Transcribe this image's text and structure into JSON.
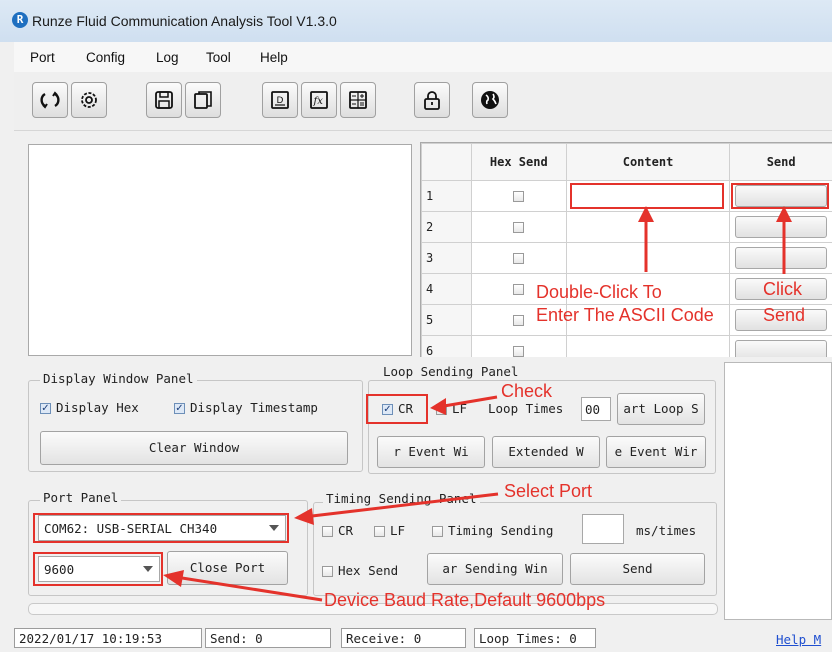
{
  "window": {
    "title": "Runze Fluid Communication Analysis Tool V1.3.0"
  },
  "menu": [
    "Port",
    "Config",
    "Log",
    "Tool",
    "Help"
  ],
  "toolbar": {
    "icons": [
      "refresh-icon",
      "settings-icon",
      "save-icon",
      "copy-icon",
      "document-icon",
      "function-icon",
      "calculator-icon",
      "lock-icon",
      "globe-icon"
    ]
  },
  "send_table": {
    "headers": [
      "",
      "Hex Send",
      "Content",
      "Send"
    ],
    "rows": [
      {
        "num": "1",
        "hex": false,
        "content": ""
      },
      {
        "num": "2",
        "hex": false,
        "content": ""
      },
      {
        "num": "3",
        "hex": false,
        "content": ""
      },
      {
        "num": "4",
        "hex": false,
        "content": ""
      },
      {
        "num": "5",
        "hex": false,
        "content": ""
      },
      {
        "num": "6",
        "hex": false,
        "content": ""
      }
    ]
  },
  "display_panel": {
    "legend": "Display Window Panel",
    "display_hex": "Display Hex",
    "display_timestamp": "Display Timestamp",
    "clear_button": "Clear Window"
  },
  "loop_panel": {
    "legend": "Loop Sending Panel",
    "cr": "CR",
    "lf": "LF",
    "loop_times_label": "Loop Times",
    "loop_times_value": "00",
    "start_button": "art Loop S",
    "btn1": "r Event Wi",
    "btn2": "Extended W",
    "btn3": "e Event Wir"
  },
  "port_panel": {
    "legend": "Port Panel",
    "port_value": "COM62: USB-SERIAL CH340",
    "baud_value": "9600",
    "close_button": "Close Port"
  },
  "timing_panel": {
    "legend": "Timing Sending Panel",
    "cr": "CR",
    "lf": "LF",
    "timing_label": "Timing Sending",
    "ms_value": "",
    "unit": "ms/times",
    "hex_send": "Hex Send",
    "clear_button": "ar Sending Win",
    "send_button": "Send"
  },
  "status": {
    "timestamp": "2022/01/17 10:19:53",
    "send": "Send: 0",
    "receive": "Receive: 0",
    "loop_times": "Loop Times: 0",
    "help": "Help M"
  },
  "annotations": {
    "double_click_1": "Double-Click To",
    "double_click_2": "Enter The ASCII Code",
    "click": "Click",
    "send": "Send",
    "check": "Check",
    "select_port": "Select Port",
    "baud_rate": "Device Baud Rate,Default 9600bps"
  },
  "colors": {
    "annotation": "#e4322b",
    "link": "#1f4fd0"
  }
}
